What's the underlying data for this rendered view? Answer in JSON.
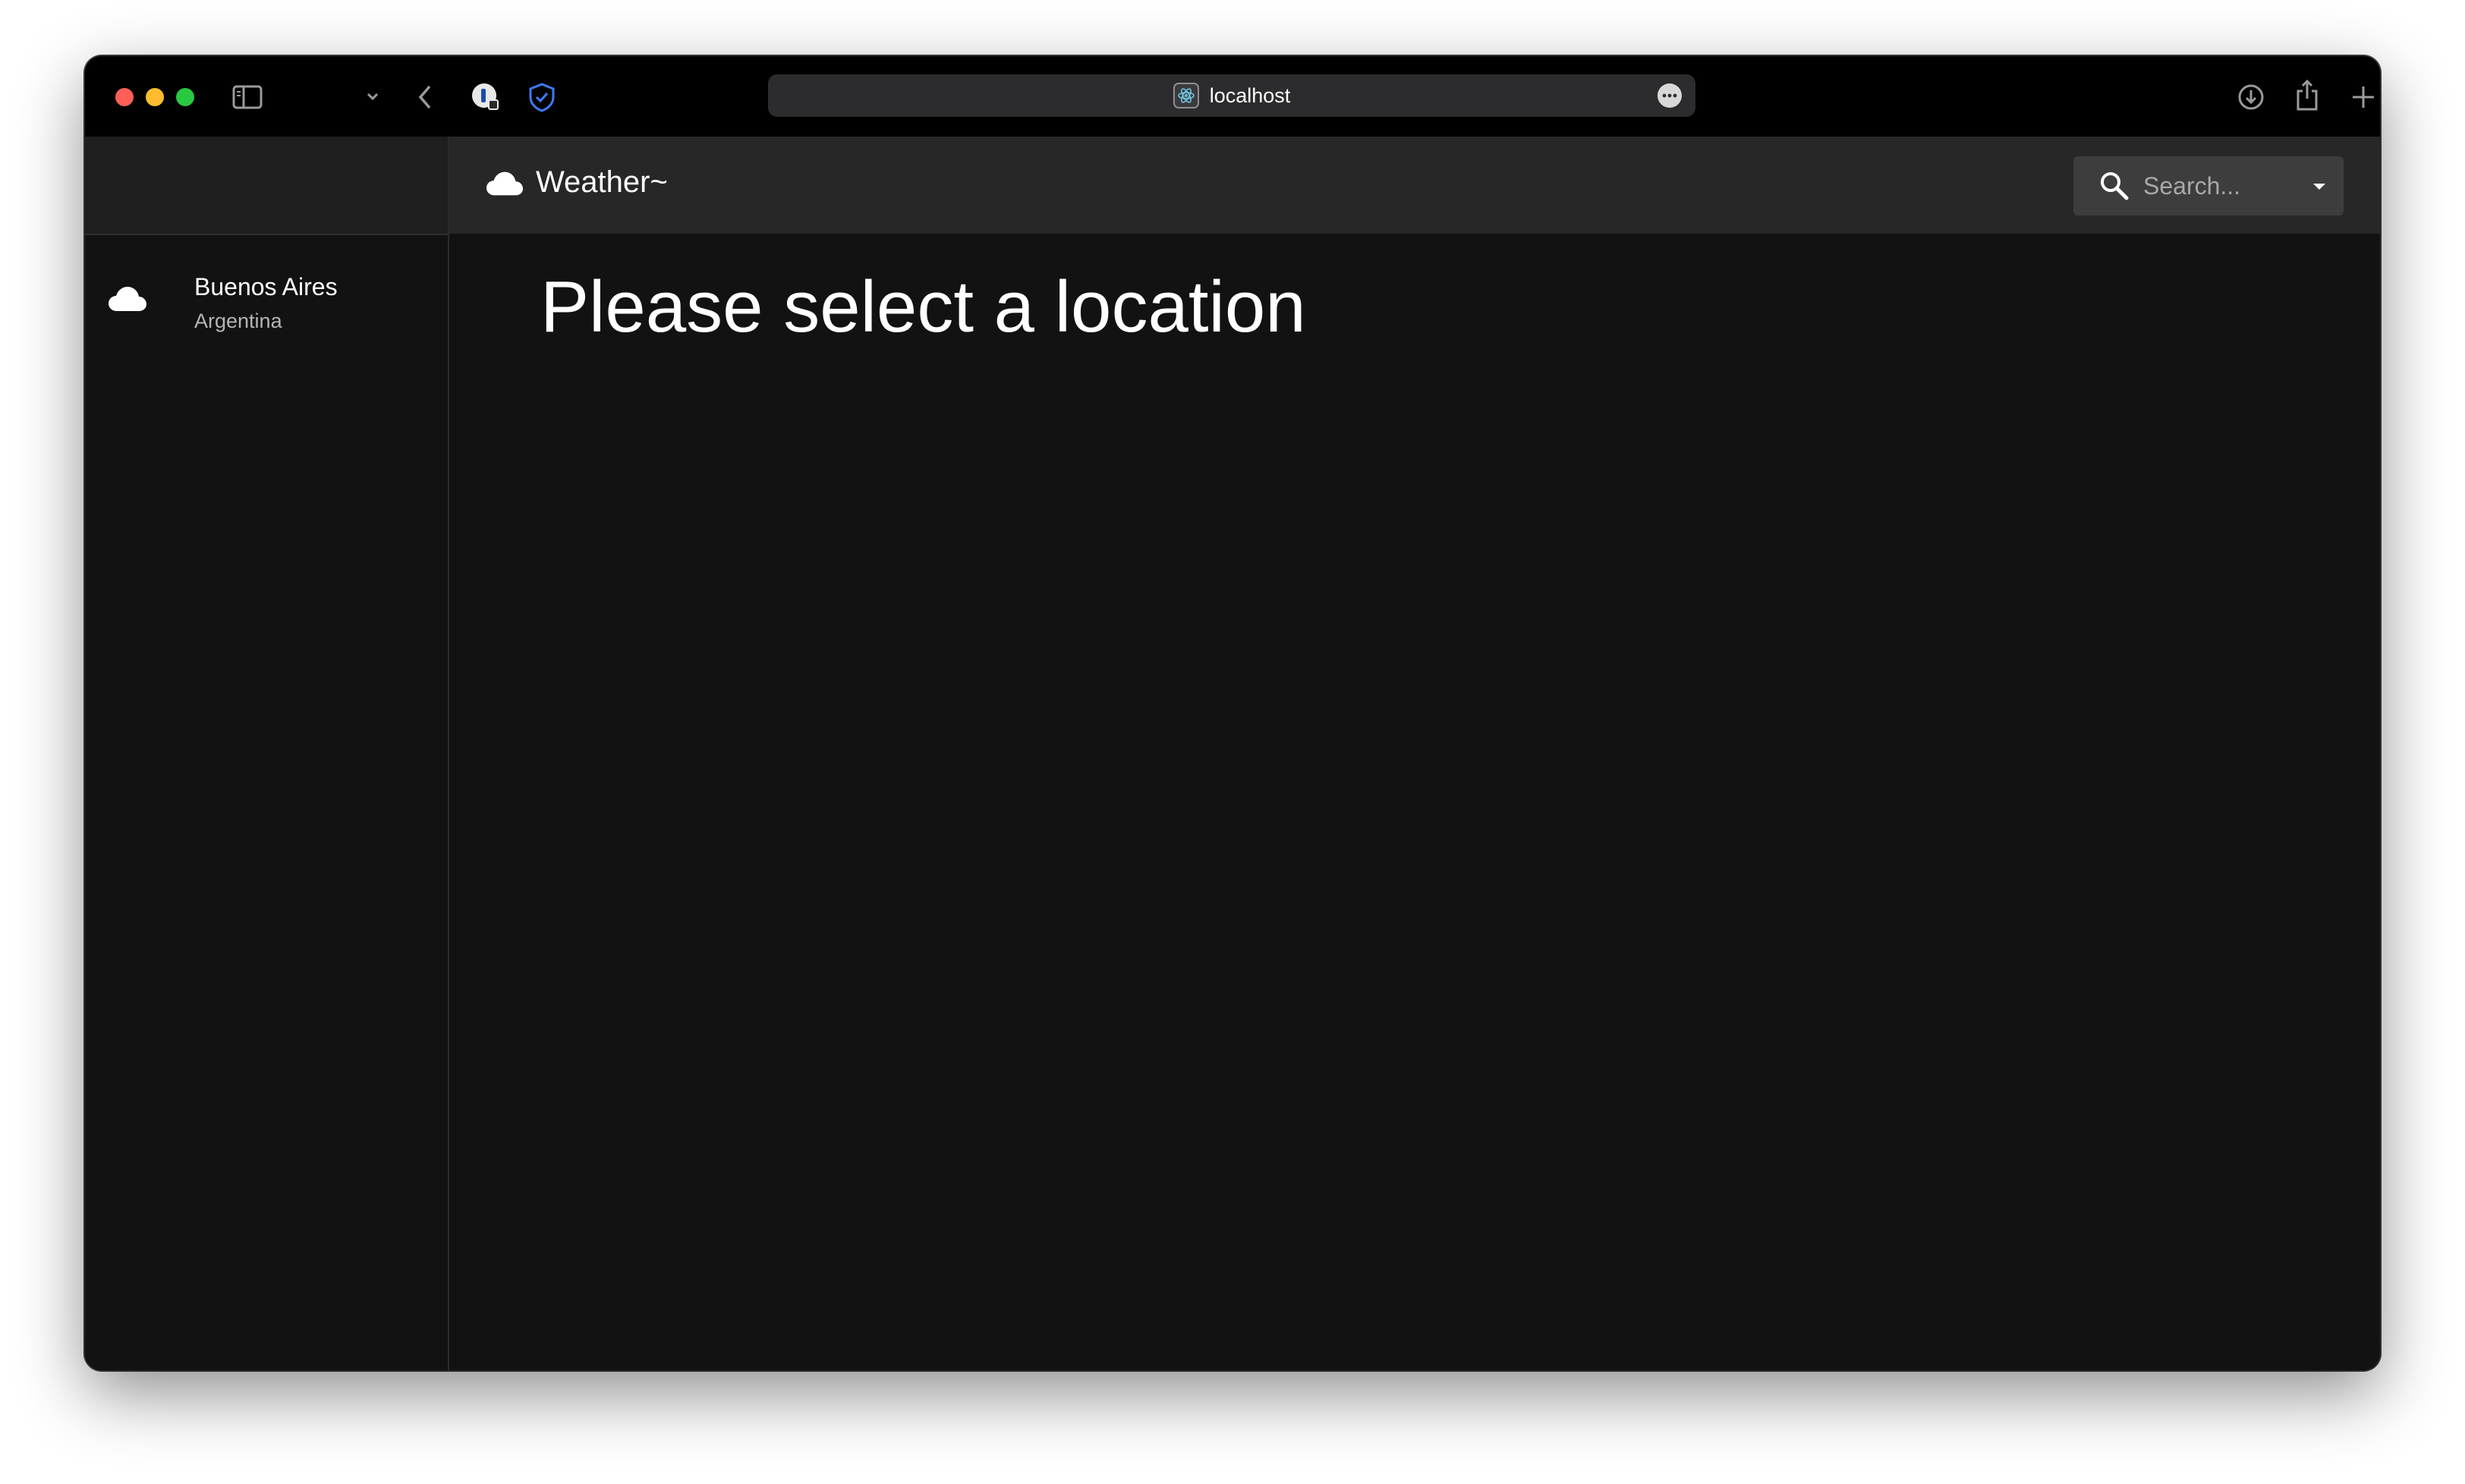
{
  "browser": {
    "url": "localhost",
    "icons": [
      "sidebar-toggle-icon",
      "chevron-down-icon",
      "back-icon",
      "password-manager-icon",
      "privacy-shield-icon",
      "favicon-icon",
      "more-icon",
      "download-icon",
      "share-icon",
      "new-tab-icon",
      "tab-overview-icon"
    ]
  },
  "app": {
    "title": "Weather~",
    "icon": "cloud-icon",
    "search": {
      "placeholder": "Search...",
      "value": ""
    }
  },
  "sidebar": {
    "locations": [
      {
        "name": "Buenos Aires",
        "country": "Argentina",
        "icon": "cloud-icon"
      }
    ]
  },
  "main": {
    "heading": "Please select a location"
  },
  "colors": {
    "window_bg": "#121212",
    "appbar_bg": "#272727",
    "search_bg": "#3d3d3d",
    "traffic_red": "#fe5f57",
    "traffic_yellow": "#febc2e",
    "traffic_green": "#28c840",
    "shield_blue": "#3d7bfd"
  }
}
